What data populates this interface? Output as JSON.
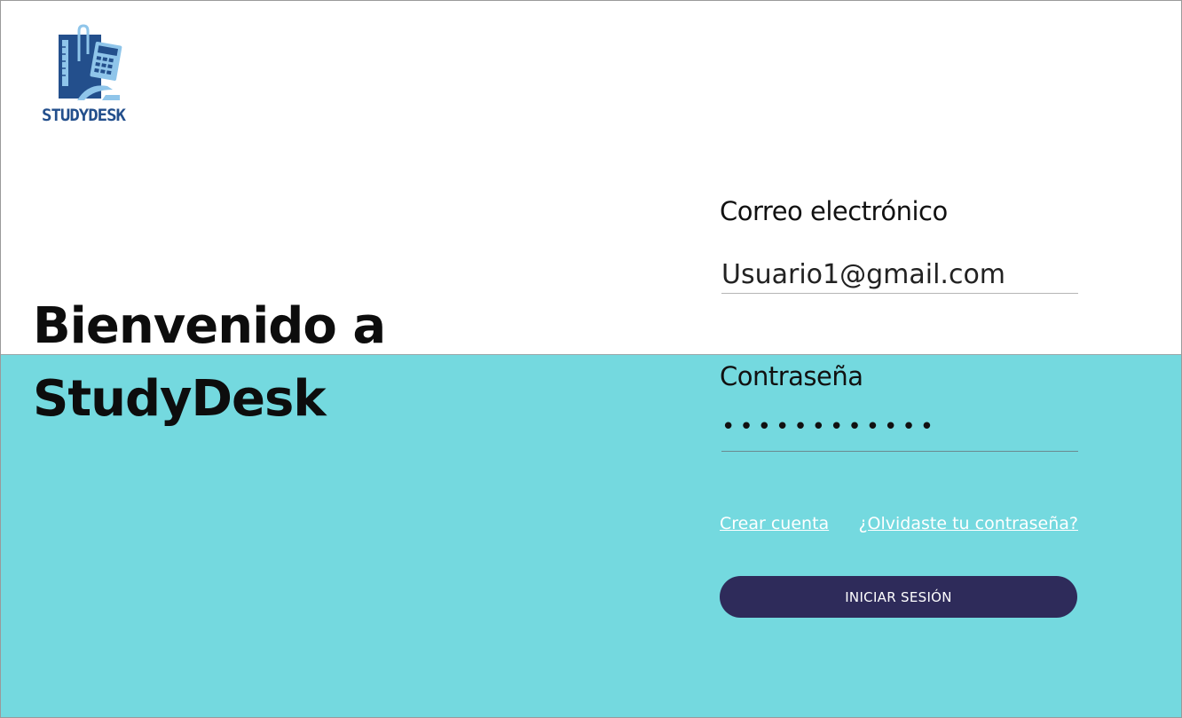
{
  "brand": {
    "name": "STUDYDESK",
    "colors": {
      "blue": "#234f8c",
      "light_blue": "#8fc5ea"
    }
  },
  "welcome": {
    "line1": "Bienvenido a",
    "line2": "StudyDesk"
  },
  "login_form": {
    "email_label": "Correo electrónico",
    "email_value": "Usuario1@gmail.com",
    "password_label": "Contraseña",
    "password_value": "••••••••••••",
    "create_account_link": "Crear cuenta",
    "forgot_password_link": "¿Olvidaste tu contraseña?",
    "submit_label": "INICIAR SESIÓN"
  },
  "colors": {
    "background_top": "#ffffff",
    "background_bottom": "#74d9df",
    "button": "#2e2b5a",
    "link": "#ffffff"
  }
}
